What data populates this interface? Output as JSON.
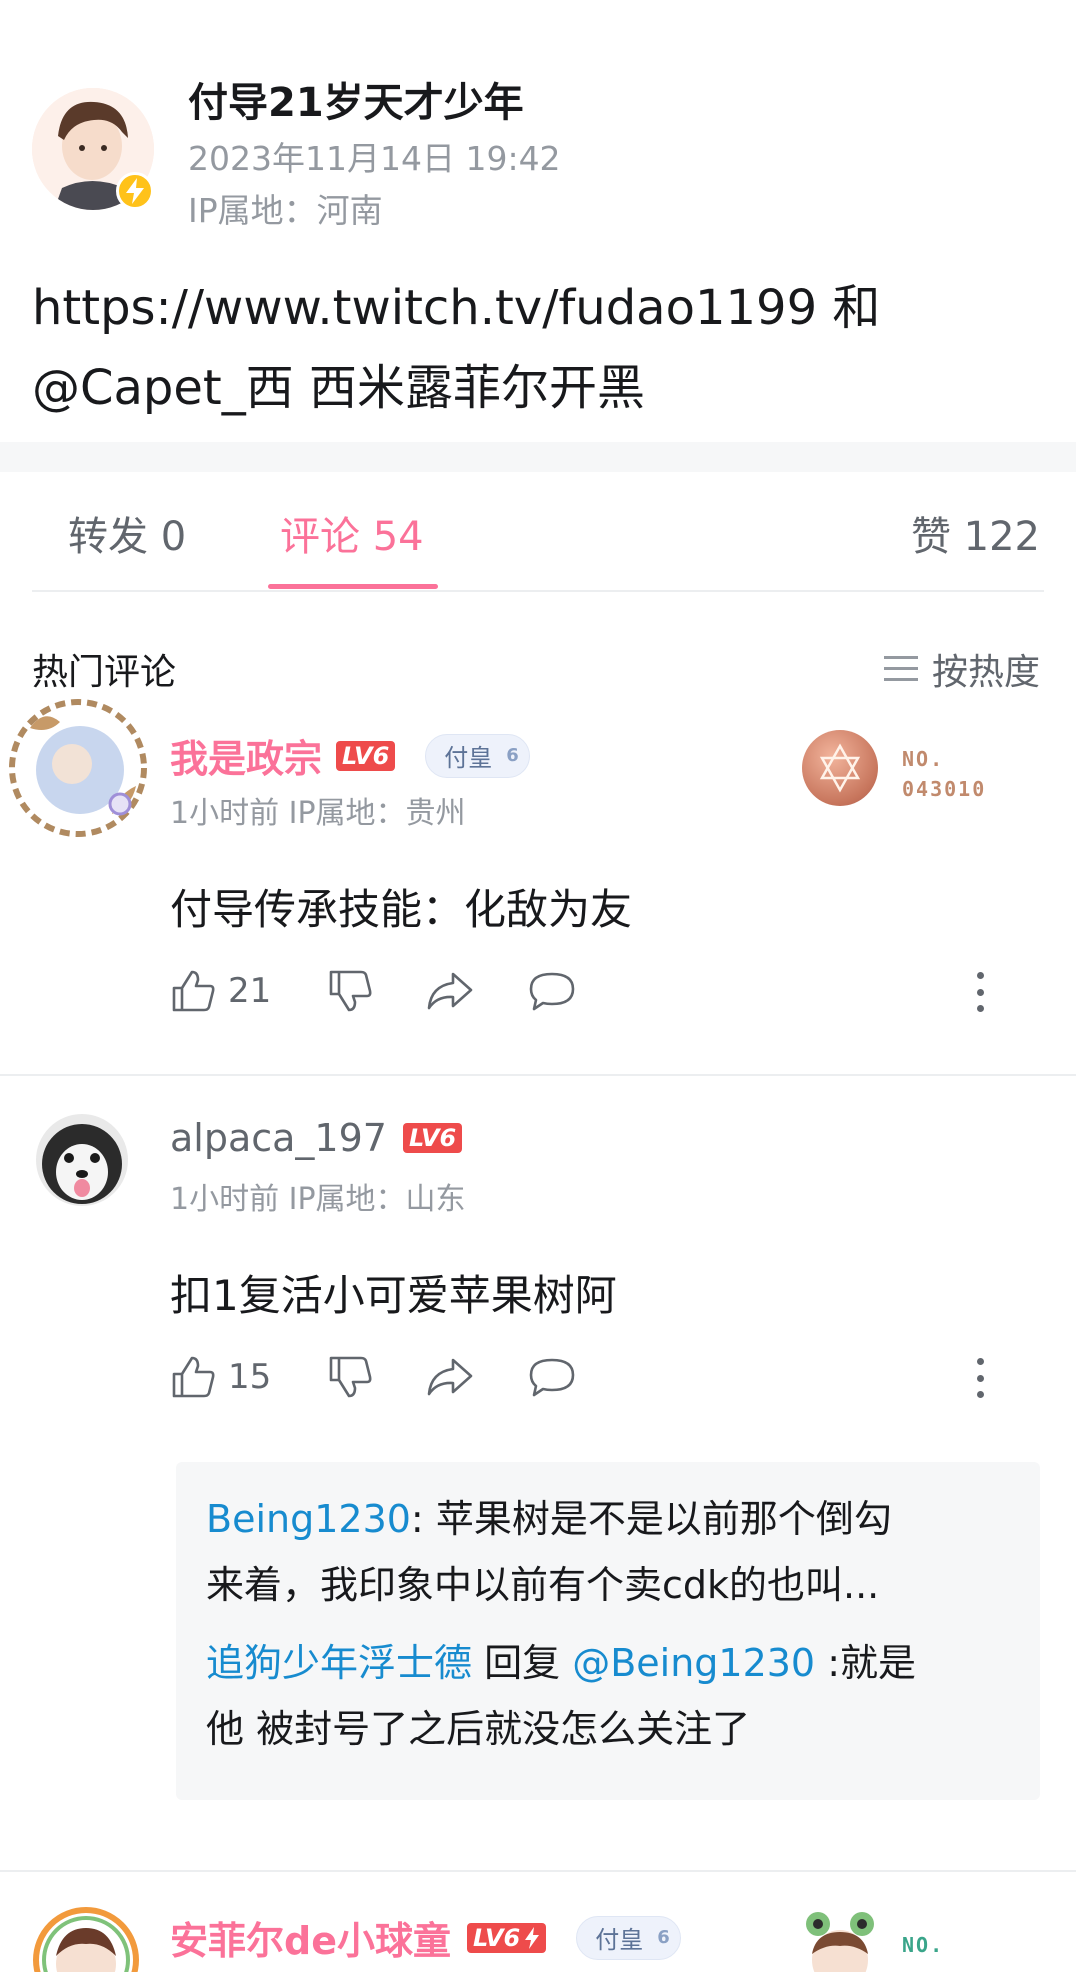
{
  "post": {
    "author": "付导21岁天才少年",
    "time": "2023年11月14日 19:42",
    "ip": "IP属地：河南",
    "text_line1": "https://www.twitch.tv/fudao1199  和",
    "text_line2": "@Capet_西   西米露菲尔开黑"
  },
  "tabs": {
    "forward": "转发 0",
    "comments": "评论 54",
    "likes": "赞 122"
  },
  "hot": {
    "title": "热门评论",
    "sort_label": "按热度"
  },
  "comments": [
    {
      "name": "我是政宗",
      "level": "LV6",
      "medal_name": "付皇",
      "medal_level": "6",
      "meta": "1小时前  IP属地：贵州",
      "text": "付导传承技能：化敌为友",
      "likes": "21",
      "nft_no_label": "NO.",
      "nft_no_value": "043010",
      "nft_color": "#c18a6d"
    },
    {
      "name": "alpaca_197",
      "level": "LV6",
      "meta": "1小时前  IP属地：山东",
      "text": "扣1复活小可爱苹果树阿",
      "likes": "15",
      "replies": [
        {
          "user": "Being1230",
          "sep": ": ",
          "text_a": "苹果树是不是以前那个倒勾",
          "text_b": "来着，我印象中以前有个卖cdk的也叫..."
        },
        {
          "user": "追狗少年浮士德",
          "mid": " 回复 ",
          "target": "@Being1230",
          "text_a": " :就是",
          "text_b": "他 被封号了之后就没怎么关注了"
        }
      ]
    },
    {
      "name": "安菲尔de小球童",
      "level": "LV6",
      "medal_name": "付皇",
      "medal_level": "6",
      "nft_no_label": "NO.",
      "nft_color": "#3aa58a"
    }
  ],
  "icons": {
    "verified": "lightning-icon",
    "like": "thumb-up-icon",
    "dislike": "thumb-down-icon",
    "share": "share-icon",
    "reply": "comment-icon",
    "more": "more-vertical-icon",
    "sort": "menu-icon"
  },
  "colors": {
    "accent_pink": "#fb7299",
    "link_blue": "#178bcf",
    "level_red": "#ee4b4b",
    "text_gray": "#9499a0"
  }
}
